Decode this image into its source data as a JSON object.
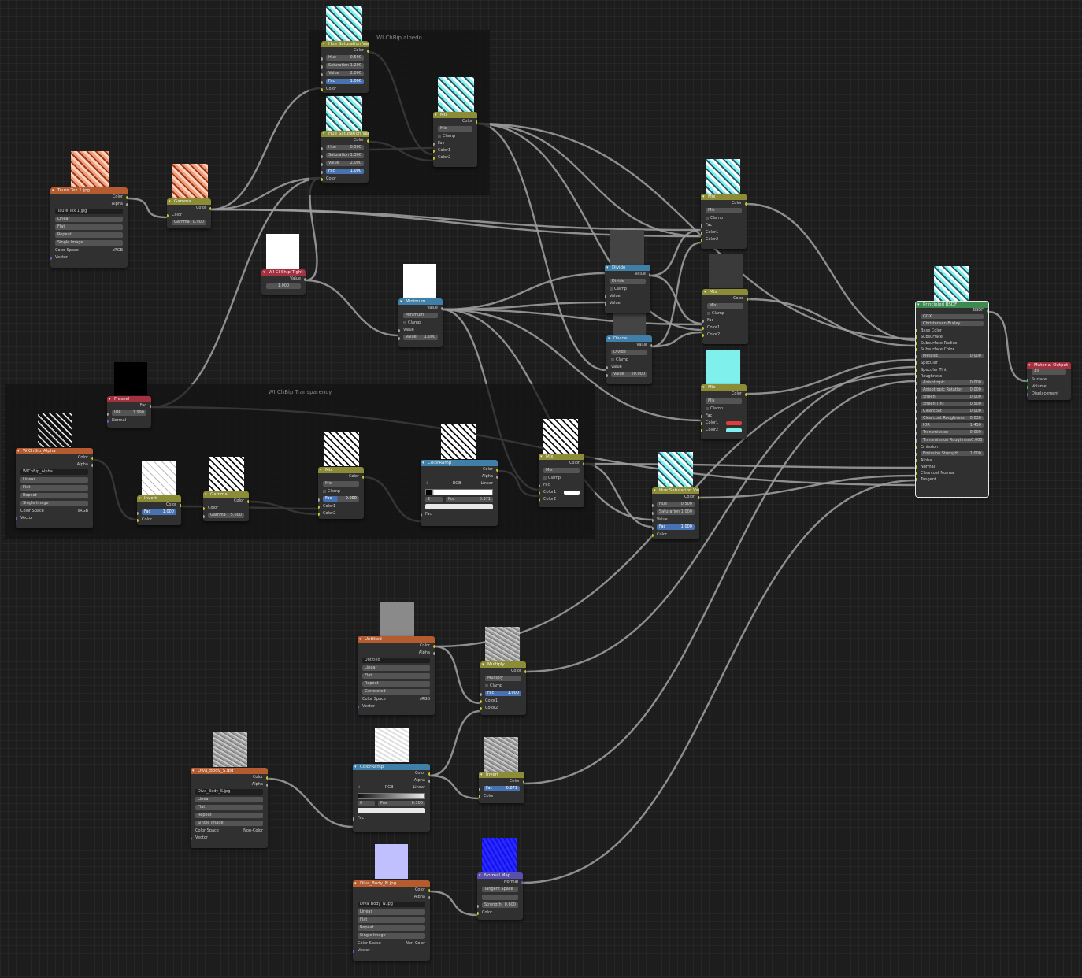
{
  "frames": [
    {
      "label": "WI ChBip albedo"
    },
    {
      "label": "WI ChBip Transparency"
    }
  ],
  "nodes": {
    "taure_tex": {
      "title": "Taure Tex 1.jpg",
      "outputs": [
        "Color",
        "Alpha"
      ],
      "file": "Taure Tex 1.jpg",
      "options": [
        "Linear",
        "Flat",
        "Repeat",
        "Single Image"
      ],
      "color_space_label": "Color Space",
      "color_space": "sRGB",
      "vector": "Vector"
    },
    "gamma_top": {
      "title": "Gamma",
      "output": "Color",
      "input": "Color",
      "field_label": "Gamma",
      "field_value": "0.900"
    },
    "hsv_top1": {
      "title": "Hue Saturation Value",
      "output": "Color",
      "fields": [
        [
          "Hue",
          "0.500"
        ],
        [
          "Saturation",
          "1.200"
        ],
        [
          "Value",
          "2.000"
        ],
        [
          "Fac",
          "1.000"
        ]
      ],
      "input": "Color"
    },
    "hsv_top2": {
      "title": "Hue Saturation Value",
      "output": "Color",
      "fields": [
        [
          "Hue",
          "0.500"
        ],
        [
          "Saturation",
          "1.300"
        ],
        [
          "Value",
          "2.000"
        ],
        [
          "Fac",
          "1.000"
        ]
      ],
      "input": "Color"
    },
    "mix_top": {
      "title": "Mix",
      "output": "Color",
      "mode": "Mix",
      "clamp": "Clamp",
      "inputs": [
        "Fac",
        "Color1",
        "Color2"
      ]
    },
    "rgb_value": {
      "title": "WI Cl Ship Tight",
      "output": "Value",
      "value": "1.000"
    },
    "minimum": {
      "title": "Minimum",
      "output": "Value",
      "mode": "Minimum",
      "clamp": "Clamp",
      "input": "Value",
      "field_label": "Value",
      "field_value": "1.000"
    },
    "divide1": {
      "title": "Divide",
      "output": "Value",
      "mode": "Divide",
      "clamp": "Clamp",
      "inputs": [
        "Value",
        "Value"
      ]
    },
    "divide2": {
      "title": "Divide",
      "output": "Value",
      "mode": "Divide",
      "clamp": "Clamp",
      "input": "Value",
      "field_label": "Value",
      "field_value": "20.000"
    },
    "mix_r1": {
      "title": "Mix",
      "output": "Color",
      "mode": "Mix",
      "clamp": "Clamp",
      "inputs": [
        "Fac",
        "Color1",
        "Color2"
      ]
    },
    "mix_r2": {
      "title": "Mix",
      "output": "Color",
      "mode": "Mix",
      "clamp": "Clamp",
      "inputs": [
        "Fac",
        "Color1",
        "Color2"
      ]
    },
    "mix_r3": {
      "title": "Mix",
      "output": "Color",
      "mode": "Mix",
      "clamp": "Clamp",
      "inputs": [
        "Fac",
        "Color1",
        "Color2"
      ],
      "colors": [
        "#e03c3c",
        "#7ff0ec"
      ]
    },
    "fresnel": {
      "title": "Fresnel",
      "output": "Fac",
      "field_label": "IOR",
      "field_value": "1.990",
      "input": "Normal"
    },
    "alpha_tex": {
      "title": "WIChBip_Alpha",
      "outputs": [
        "Color",
        "Alpha"
      ],
      "file": "WIChBip_Alpha",
      "options": [
        "Linear",
        "Flat",
        "Repeat",
        "Single Image"
      ],
      "color_space_label": "Color Space",
      "color_space": "sRGB",
      "vector": "Vector"
    },
    "invert": {
      "title": "Invert",
      "output": "Color",
      "fac_label": "Fac",
      "fac_value": "1.000",
      "input": "Color"
    },
    "gamma_mid": {
      "title": "Gamma",
      "output": "Color",
      "input": "Color",
      "field_label": "Gamma",
      "field_value": "5.000"
    },
    "mix_mid": {
      "title": "Mix",
      "output": "Color",
      "mode": "Mix",
      "clamp": "Clamp",
      "fac_label": "Fac",
      "fac_value": "0.000",
      "inputs": [
        "Color1",
        "Color2"
      ]
    },
    "colorramp_mid": {
      "title": "ColorRamp",
      "outputs": [
        "Color",
        "Alpha"
      ],
      "rgb": "RGB",
      "interp": "Linear",
      "pos_index": "2",
      "pos_label": "Pos",
      "pos_value": "0.371",
      "input": "Fac"
    },
    "mix_mid2": {
      "title": "Mix",
      "output": "Color",
      "mode": "Mix",
      "clamp": "Clamp",
      "inputs": [
        "Fac",
        "Color1",
        "Color2"
      ]
    },
    "hsv_mid": {
      "title": "Hue Saturation Value",
      "output": "Color",
      "fields": [
        [
          "Hue",
          "0.500"
        ],
        [
          "Saturation",
          "1.000"
        ],
        [
          "Value",
          ""
        ],
        [
          "Fac",
          "1.000"
        ]
      ],
      "input": "Color"
    },
    "bsdf": {
      "title": "Principled BSDF",
      "output": "BSDF",
      "dist": "GGX",
      "sss": "Christensen-Burley",
      "rows": [
        {
          "label": "Base Color",
          "value": ""
        },
        {
          "label": "Subsurface",
          "value": ""
        },
        {
          "label": "Subsurface Radius",
          "value": ""
        },
        {
          "label": "Subsurface Color",
          "value": ""
        },
        {
          "label": "Metallic",
          "value": "0.000"
        },
        {
          "label": "Specular",
          "value": ""
        },
        {
          "label": "Specular Tint",
          "value": ""
        },
        {
          "label": "Roughness",
          "value": ""
        },
        {
          "label": "Anisotropic",
          "value": "0.000"
        },
        {
          "label": "Anisotropic Rotation",
          "value": "0.000"
        },
        {
          "label": "Sheen",
          "value": "0.000"
        },
        {
          "label": "Sheen Tint",
          "value": "0.500"
        },
        {
          "label": "Clearcoat",
          "value": "0.000"
        },
        {
          "label": "Clearcoat Roughness",
          "value": "0.030"
        },
        {
          "label": "IOR",
          "value": "1.450"
        },
        {
          "label": "Transmission",
          "value": "0.000"
        },
        {
          "label": "Transmission Roughness",
          "value": "0.000"
        },
        {
          "label": "Emission",
          "value": ""
        },
        {
          "label": "Emission Strength",
          "value": "1.000"
        },
        {
          "label": "Alpha",
          "value": ""
        },
        {
          "label": "Normal",
          "value": ""
        },
        {
          "label": "Clearcoat Normal",
          "value": ""
        },
        {
          "label": "Tangent",
          "value": ""
        }
      ]
    },
    "output": {
      "title": "Material Output",
      "target": "All",
      "inputs": [
        "Surface",
        "Volume",
        "Displacement"
      ]
    },
    "untitled_tex": {
      "title": "Untitled",
      "outputs": [
        "Color",
        "Alpha"
      ],
      "file": "Untitled",
      "options": [
        "Linear",
        "Flat",
        "Repeat",
        "Generated"
      ],
      "color_space_label": "Color Space",
      "color_space": "sRGB",
      "vector": "Vector"
    },
    "multiply": {
      "title": "Multiply",
      "output": "Color",
      "mode": "Multiply",
      "clamp": "Clamp",
      "fac_label": "Fac",
      "fac_value": "1.000",
      "inputs": [
        "Color1",
        "Color2"
      ]
    },
    "colorramp_low": {
      "title": "ColorRamp",
      "outputs": [
        "Color",
        "Alpha"
      ],
      "rgb": "RGB",
      "interp": "Linear",
      "pos_index": "0",
      "pos_label": "Pos",
      "pos_value": "0.100",
      "input": "Fac"
    },
    "invert_low": {
      "title": "Invert",
      "output": "Color",
      "fac_label": "Fac",
      "fac_value": "0.871",
      "input": "Color"
    },
    "body_s_tex": {
      "title": "Diva_Body_S.jpg",
      "outputs": [
        "Color",
        "Alpha"
      ],
      "file": "Diva_Body_S.jpg",
      "options": [
        "Linear",
        "Flat",
        "Repeat",
        "Single Image"
      ],
      "color_space_label": "Color Space",
      "color_space": "Non-Color",
      "vector": "Vector"
    },
    "body_n_tex": {
      "title": "Diva_Body_N.jpg",
      "outputs": [
        "Color",
        "Alpha"
      ],
      "file": "Diva_Body_N.jpg",
      "options": [
        "Linear",
        "Flat",
        "Repeat",
        "Single Image"
      ],
      "color_space_label": "Color Space",
      "color_space": "Non-Color",
      "vector": "Vector"
    },
    "normal_map": {
      "title": "Normal Map",
      "output": "Normal",
      "space": "Tangent Space",
      "field_label": "Strength",
      "field_value": "0.600",
      "input": "Color"
    }
  }
}
